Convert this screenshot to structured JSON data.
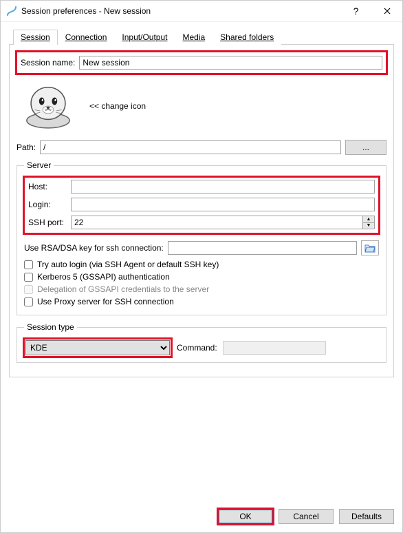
{
  "window": {
    "title": "Session preferences - New session"
  },
  "tabs": {
    "session": "Session",
    "connection": "Connection",
    "io": "Input/Output",
    "media": "Media",
    "shared": "Shared folders"
  },
  "session_name": {
    "label": "Session name:",
    "value": "New session"
  },
  "change_icon": "<< change icon",
  "path": {
    "label": "Path:",
    "value": "/",
    "browse": "..."
  },
  "server": {
    "legend": "Server",
    "host_label": "Host:",
    "host_value": "",
    "login_label": "Login:",
    "login_value": "",
    "sshport_label": "SSH port:",
    "sshport_value": "22",
    "rsa_label": "Use RSA/DSA key for ssh connection:",
    "rsa_value": "",
    "auto_login": "Try auto login (via SSH Agent or default SSH key)",
    "kerberos": "Kerberos 5 (GSSAPI) authentication",
    "delegation": "Delegation of GSSAPI credentials to the server",
    "proxy": "Use Proxy server for SSH connection"
  },
  "session_type": {
    "legend": "Session type",
    "selected": "KDE",
    "command_label": "Command:",
    "command_value": ""
  },
  "buttons": {
    "ok": "OK",
    "cancel": "Cancel",
    "defaults": "Defaults"
  }
}
